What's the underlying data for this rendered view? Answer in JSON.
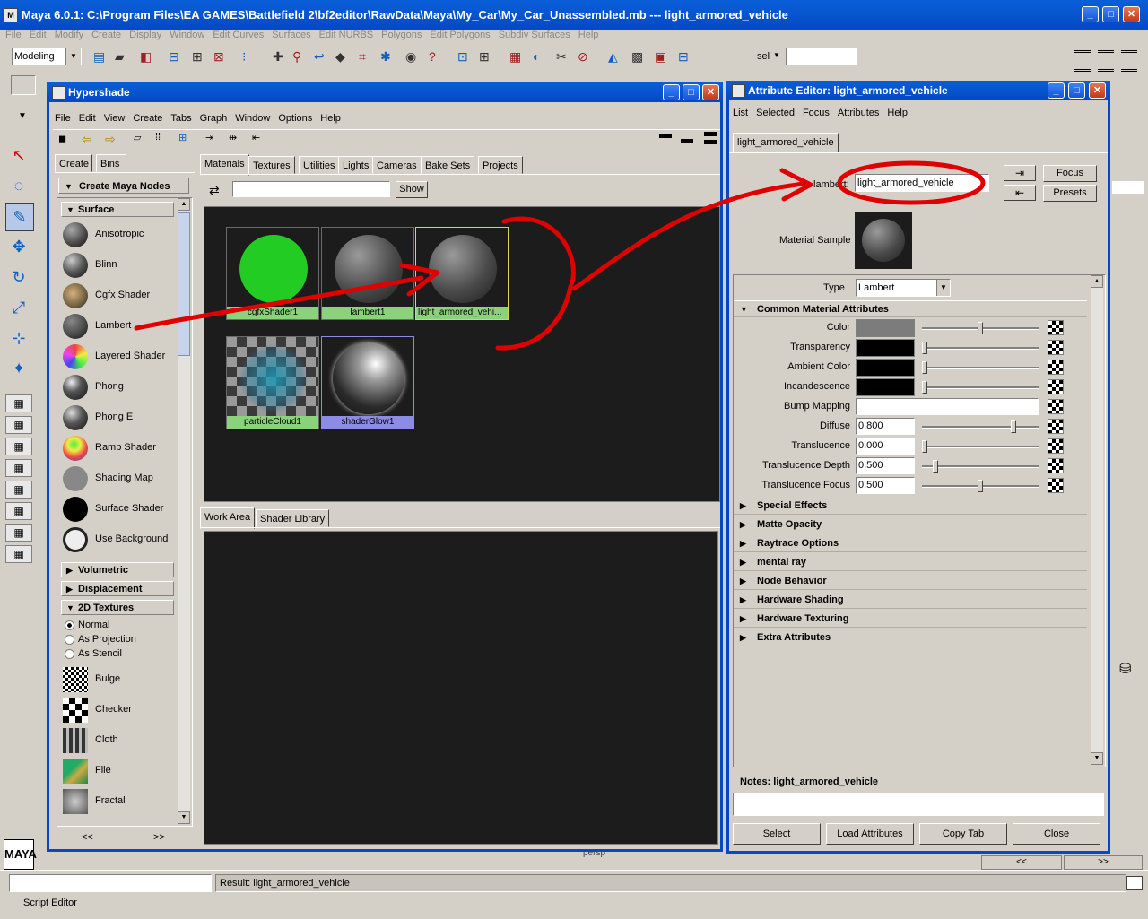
{
  "app": {
    "title": "Maya 6.0.1: C:\\Program Files\\EA GAMES\\Battlefield 2\\bf2editor\\RawData\\Maya\\My_Car\\My_Car_Unassembled.mb   ---   light_armored_vehicle"
  },
  "main_menu": [
    "File",
    "Edit",
    "Modify",
    "Create",
    "Display",
    "Window",
    "Edit Curves",
    "Surfaces",
    "Edit NURBS",
    "Polygons",
    "Edit Polygons",
    "Subdiv Surfaces",
    "Help"
  ],
  "status_line": {
    "mode": "Modeling",
    "sel_label": "sel",
    "sel_value": ""
  },
  "hypershade": {
    "title": "Hypershade",
    "menu": [
      "File",
      "Edit",
      "View",
      "Create",
      "Tabs",
      "Graph",
      "Window",
      "Options",
      "Help"
    ],
    "left_tabs": [
      "Create",
      "Bins"
    ],
    "create_header": "Create Maya Nodes",
    "surface_header": "Surface",
    "surface_nodes": [
      "Anisotropic",
      "Blinn",
      "Cgfx Shader",
      "Lambert",
      "Layered Shader",
      "Phong",
      "Phong E",
      "Ramp Shader",
      "Shading Map",
      "Surface Shader",
      "Use Background"
    ],
    "collapsed_sections": [
      "Volumetric",
      "Displacement"
    ],
    "textures_header": "2D Textures",
    "texture_modes": [
      "Normal",
      "As Projection",
      "As Stencil"
    ],
    "texture_nodes": [
      "Bulge",
      "Checker",
      "Cloth",
      "File",
      "Fractal"
    ],
    "scroll_left": "<<",
    "scroll_right": ">>",
    "top_tabs": [
      "Materials",
      "Textures",
      "Utilities",
      "Lights",
      "Cameras",
      "Bake Sets",
      "Projects"
    ],
    "filter_value": "",
    "show_button": "Show",
    "swatches": [
      "cgfxShader1",
      "lambert1",
      "light_armored_vehi...",
      "particleCloud1",
      "shaderGlow1"
    ],
    "bottom_tabs": [
      "Work Area",
      "Shader Library"
    ]
  },
  "attribute_editor": {
    "title": "Attribute Editor: light_armored_vehicle",
    "menu": [
      "List",
      "Selected",
      "Focus",
      "Attributes",
      "Help"
    ],
    "node_tab": "light_armored_vehicle",
    "node_type_label": "lambert:",
    "node_name": "light_armored_vehicle",
    "focus_button": "Focus",
    "presets_button": "Presets",
    "material_sample_label": "Material Sample",
    "type_label": "Type",
    "type_value": "Lambert",
    "common_header": "Common Material Attributes",
    "attributes": [
      {
        "label": "Color",
        "kind": "color",
        "color": "#7c7c7c",
        "slider": 0.5
      },
      {
        "label": "Transparency",
        "kind": "color",
        "color": "#000000",
        "slider": 0.0
      },
      {
        "label": "Ambient Color",
        "kind": "color",
        "color": "#000000",
        "slider": 0.0
      },
      {
        "label": "Incandescence",
        "kind": "color",
        "color": "#000000",
        "slider": 0.0
      },
      {
        "label": "Bump Mapping",
        "kind": "field"
      },
      {
        "label": "Diffuse",
        "kind": "value",
        "value": "0.800",
        "slider": 0.8
      },
      {
        "label": "Translucence",
        "kind": "value",
        "value": "0.000",
        "slider": 0.0
      },
      {
        "label": "Translucence Depth",
        "kind": "value",
        "value": "0.500",
        "slider": 0.1
      },
      {
        "label": "Translucence Focus",
        "kind": "value",
        "value": "0.500",
        "slider": 0.5
      }
    ],
    "sections": [
      "Special Effects",
      "Matte Opacity",
      "Raytrace Options",
      "mental ray",
      "Node Behavior",
      "Hardware Shading",
      "Hardware Texturing",
      "Extra Attributes"
    ],
    "notes_label": "Notes:  light_armored_vehicle",
    "notes_value": "",
    "buttons": [
      "Select",
      "Load Attributes",
      "Copy Tab",
      "Close"
    ]
  },
  "bottom": {
    "result_text": "Result: light_armored_vehicle",
    "script_editor": "Script Editor",
    "persp_label": "persp",
    "scroll_left": "<<",
    "scroll_right": ">>"
  },
  "colors": {
    "accent_blue": "#0349c4",
    "annotation_red": "#e00000",
    "swatch_label_green": "#8bd37a",
    "swatch_label_blue": "#8c8ce6"
  }
}
